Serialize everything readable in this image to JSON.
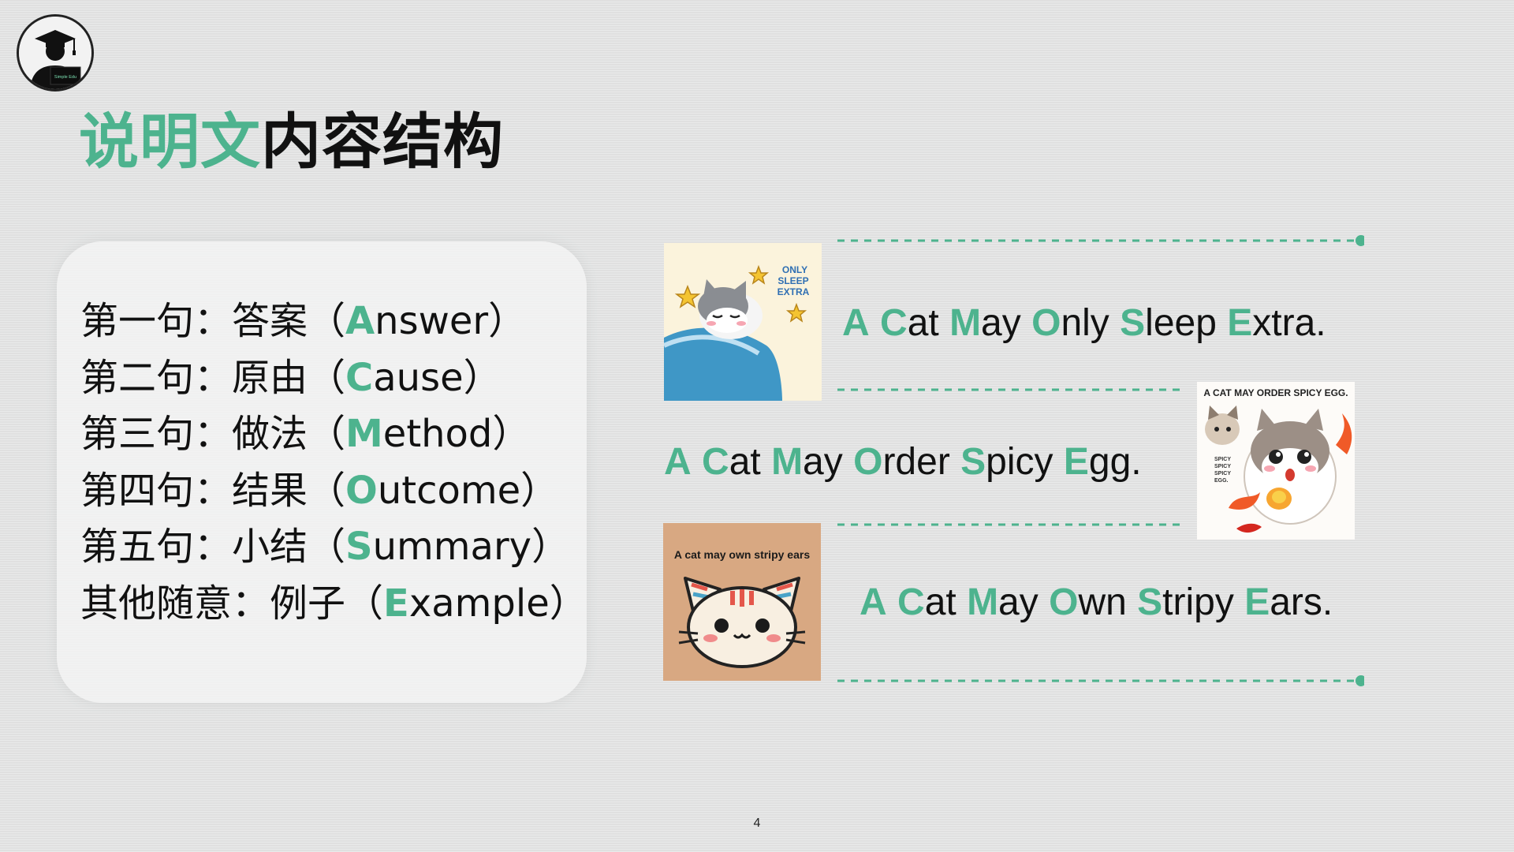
{
  "title": {
    "accent": "说明文",
    "rest": "内容结构"
  },
  "structure": [
    {
      "prefix": "第一句：答案（",
      "initial": "A",
      "rest": "nswer）"
    },
    {
      "prefix": "第二句：原由（",
      "initial": "C",
      "rest": "ause）"
    },
    {
      "prefix": "第三句：做法（",
      "initial": "M",
      "rest": "ethod）"
    },
    {
      "prefix": "第四句：结果（",
      "initial": "O",
      "rest": "utcome）"
    },
    {
      "prefix": "第五句：小结（",
      "initial": "S",
      "rest": "ummary）"
    },
    {
      "prefix": "其他随意：例子（",
      "initial": "E",
      "rest": "xample）"
    }
  ],
  "mnemonics": [
    {
      "words": [
        {
          "cap": "A",
          "rest": ""
        },
        {
          "cap": "C",
          "rest": "at"
        },
        {
          "cap": "M",
          "rest": "ay"
        },
        {
          "cap": "O",
          "rest": "nly"
        },
        {
          "cap": "S",
          "rest": "leep"
        },
        {
          "cap": "E",
          "rest": "xtra."
        }
      ]
    },
    {
      "words": [
        {
          "cap": "A",
          "rest": ""
        },
        {
          "cap": "C",
          "rest": "at"
        },
        {
          "cap": "M",
          "rest": "ay"
        },
        {
          "cap": "O",
          "rest": "rder"
        },
        {
          "cap": "S",
          "rest": "picy"
        },
        {
          "cap": "E",
          "rest": "gg."
        }
      ]
    },
    {
      "words": [
        {
          "cap": "A",
          "rest": ""
        },
        {
          "cap": "C",
          "rest": "at"
        },
        {
          "cap": "M",
          "rest": "ay"
        },
        {
          "cap": "O",
          "rest": "wn"
        },
        {
          "cap": "S",
          "rest": "tripy"
        },
        {
          "cap": "E",
          "rest": "ars."
        }
      ]
    }
  ],
  "images": {
    "sleep": {
      "caption_lines": [
        "ONLY",
        "SLEEP",
        "EXTRA"
      ]
    },
    "egg": {
      "caption": "A CAT MAY ORDER SPICY EGG.",
      "side_lines": [
        "SPICY",
        "SPICY",
        "SPICY",
        "EGG."
      ]
    },
    "ears": {
      "caption": "A cat may own stripy ears"
    }
  },
  "logo": {
    "text": "Simple Edu"
  },
  "page_number": "4",
  "colors": {
    "accent": "#4db38e",
    "text": "#111111",
    "background": "#e3e4e4",
    "card": "#f4f4f4"
  }
}
